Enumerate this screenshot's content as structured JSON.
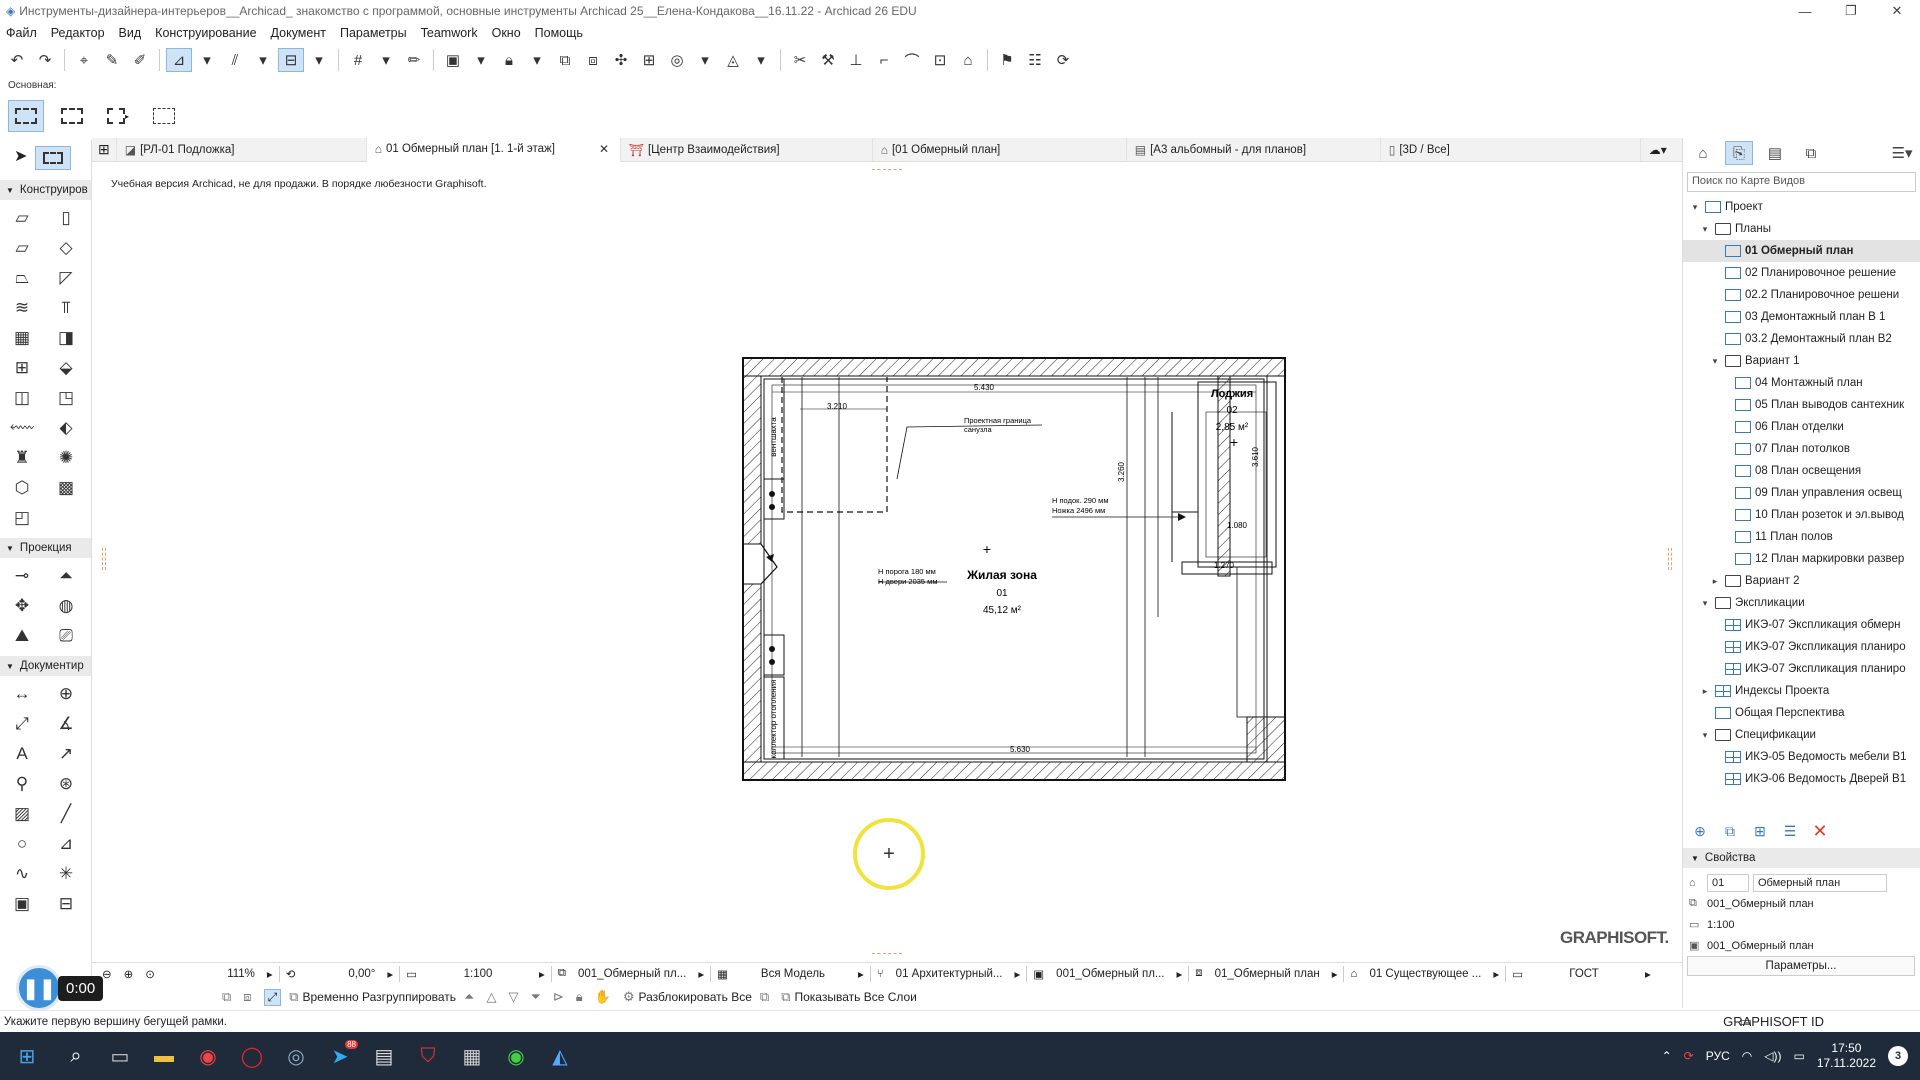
{
  "window": {
    "title": "Инструменты-дизайнера-интерьеров__Archicad_ знакомство с программой, основные инструменты Archicad 25__Елена-Кондакова__16.11.22 - Archicad 26 EDU",
    "controls": [
      "—",
      "❐",
      "✕"
    ]
  },
  "menu": [
    "Файл",
    "Редактор",
    "Вид",
    "Конструирование",
    "Документ",
    "Параметры",
    "Teamwork",
    "Окно",
    "Помощь"
  ],
  "info_box": {
    "label": "Основная:"
  },
  "left_panel": {
    "sections": [
      "Конструиров",
      "Проекция",
      "Документир"
    ]
  },
  "tabs": [
    {
      "label": "[РЛ-01 Подложка]",
      "icon": "sheet-icon",
      "active": false
    },
    {
      "label": "01 Обмерный план [1. 1-й этаж]",
      "icon": "floorplan-icon",
      "active": true
    },
    {
      "label": "[Центр Взаимодействия]",
      "icon": "interaction-icon",
      "active": false
    },
    {
      "label": "[01 Обмерный план]",
      "icon": "floorplan-icon",
      "active": false
    },
    {
      "label": "[А3 альбомный - для планов]",
      "icon": "layout-icon",
      "active": false
    },
    {
      "label": "[3D / Все]",
      "icon": "3d-icon",
      "active": false
    }
  ],
  "canvas": {
    "edu_note": "Учебная версия Archicad, не для продажи. В порядке любезности Graphisoft.",
    "logo": "GRAPHISOFT.",
    "cursor_glyph": "+",
    "plan_labels": {
      "zone_name": "Жилая зона",
      "zone_num": "01",
      "zone_area": "45,12 м²",
      "loggia_name": "Лоджия",
      "loggia_num": "02",
      "loggia_area": "2,85 м²",
      "bath_boundary_1": "Проектная граница",
      "bath_boundary_2": "санузла",
      "sill_1": "Н подок. 290 мм",
      "sill_2": "Ножка 2496 мм",
      "door_1": "Н порога 180 мм",
      "door_2": "Н двери 2035 мм",
      "dim_top": "5.430",
      "dim_bottom": "5.630",
      "dim_a": "3.210",
      "dim_b": "3.260",
      "dim_c": "1.270",
      "dim_d": "1.080",
      "dim_e": "3.610",
      "shaft_1": "вентшахта",
      "shaft_2": "коллектор отопления"
    }
  },
  "navigator": {
    "search_placeholder": "Поиск по Карте Видов",
    "tree": [
      {
        "label": "Проект",
        "level": 0,
        "twisty": "v",
        "icon": "project",
        "sel": false
      },
      {
        "label": "Планы",
        "level": 1,
        "twisty": "v",
        "icon": "folder",
        "sel": false
      },
      {
        "label": "01 Обмерный план",
        "level": 2,
        "twisty": "",
        "icon": "plan",
        "sel": true
      },
      {
        "label": "02 Планировочное решение",
        "level": 2,
        "twisty": "",
        "icon": "plan",
        "sel": false
      },
      {
        "label": "02.2 Планировочное решени",
        "level": 2,
        "twisty": "",
        "icon": "plan",
        "sel": false
      },
      {
        "label": "03 Демонтажный план В 1",
        "level": 2,
        "twisty": "",
        "icon": "plan",
        "sel": false
      },
      {
        "label": "03.2 Демонтажный план В2",
        "level": 2,
        "twisty": "",
        "icon": "plan",
        "sel": false
      },
      {
        "label": "Вариант 1",
        "level": 2,
        "twisty": "v",
        "icon": "folder",
        "sel": false
      },
      {
        "label": "04 Монтажный план",
        "level": 3,
        "twisty": "",
        "icon": "plan",
        "sel": false
      },
      {
        "label": "05 План выводов сантехник",
        "level": 3,
        "twisty": "",
        "icon": "plan",
        "sel": false
      },
      {
        "label": "06 План отделки",
        "level": 3,
        "twisty": "",
        "icon": "plan",
        "sel": false
      },
      {
        "label": "07 План потолков",
        "level": 3,
        "twisty": "",
        "icon": "plan",
        "sel": false
      },
      {
        "label": "08 План освещения",
        "level": 3,
        "twisty": "",
        "icon": "plan",
        "sel": false
      },
      {
        "label": "09 План управления освещ",
        "level": 3,
        "twisty": "",
        "icon": "plan",
        "sel": false
      },
      {
        "label": "10 План розеток и эл.вывод",
        "level": 3,
        "twisty": "",
        "icon": "plan",
        "sel": false
      },
      {
        "label": "11 План полов",
        "level": 3,
        "twisty": "",
        "icon": "plan",
        "sel": false
      },
      {
        "label": "12 План маркировки развер",
        "level": 3,
        "twisty": "",
        "icon": "plan",
        "sel": false
      },
      {
        "label": "Вариант 2",
        "level": 2,
        "twisty": ">",
        "icon": "folder",
        "sel": false
      },
      {
        "label": "Экспликации",
        "level": 1,
        "twisty": "v",
        "icon": "folder",
        "sel": false
      },
      {
        "label": "ИКЭ-07 Экспликация обмерн",
        "level": 2,
        "twisty": "",
        "icon": "grid",
        "sel": false
      },
      {
        "label": "ИКЭ-07 Экспликация планиро",
        "level": 2,
        "twisty": "",
        "icon": "grid",
        "sel": false
      },
      {
        "label": "ИКЭ-07 Экспликация планиро",
        "level": 2,
        "twisty": "",
        "icon": "grid",
        "sel": false
      },
      {
        "label": "Индексы Проекта",
        "level": 1,
        "twisty": ">",
        "icon": "grid",
        "sel": false
      },
      {
        "label": "Общая Перспектива",
        "level": 1,
        "twisty": "",
        "icon": "plan",
        "sel": false
      },
      {
        "label": "Спецификации",
        "level": 1,
        "twisty": "v",
        "icon": "folder",
        "sel": false
      },
      {
        "label": "ИКЭ-05 Ведомость мебели В1",
        "level": 2,
        "twisty": "",
        "icon": "grid",
        "sel": false
      },
      {
        "label": "ИКЭ-06 Ведомость Дверей В1",
        "level": 2,
        "twisty": "",
        "icon": "grid",
        "sel": false
      }
    ],
    "properties_title": "Свойства",
    "prop_id": "01",
    "prop_name": "Обмерный план",
    "prop_rows": [
      "001_Обмерный план",
      "1:100",
      "001_Обмерный план"
    ],
    "params_button": "Параметры..."
  },
  "nav_bar": {
    "zoom": "111%",
    "angle": "0,00°",
    "scale": "1:100",
    "layers": "001_Обмерный пл...",
    "model": "Вся Модель",
    "pen_set": "01 Архитектурный...",
    "mvo": "001_Обмерный пл...",
    "view": "01_Обмерный план",
    "renovation": "01 Существующее ...",
    "dim_std": "ГОСТ"
  },
  "option_bar": {
    "ungroup": "Временно Разгруппировать",
    "unlock": "Разблокировать Все",
    "show_layers": "Показывать Все Слои"
  },
  "status": {
    "hint": "Укажите первую вершину бегущей рамки.",
    "graphisoft_id": "GRAPHISOFT ID"
  },
  "recorder": {
    "time": "0:00",
    "pause": "❚❚"
  },
  "taskbar": {
    "lang": "РУС",
    "time": "17:50",
    "date": "17.11.2022",
    "notifications": "3",
    "badge": "88"
  },
  "colors": {
    "accent": "#3a78b8",
    "selection": "#cfe3f6",
    "cursor_ring": "#f2e33c",
    "taskbar": "#1f2b3a",
    "delete": "#e03b2a"
  }
}
